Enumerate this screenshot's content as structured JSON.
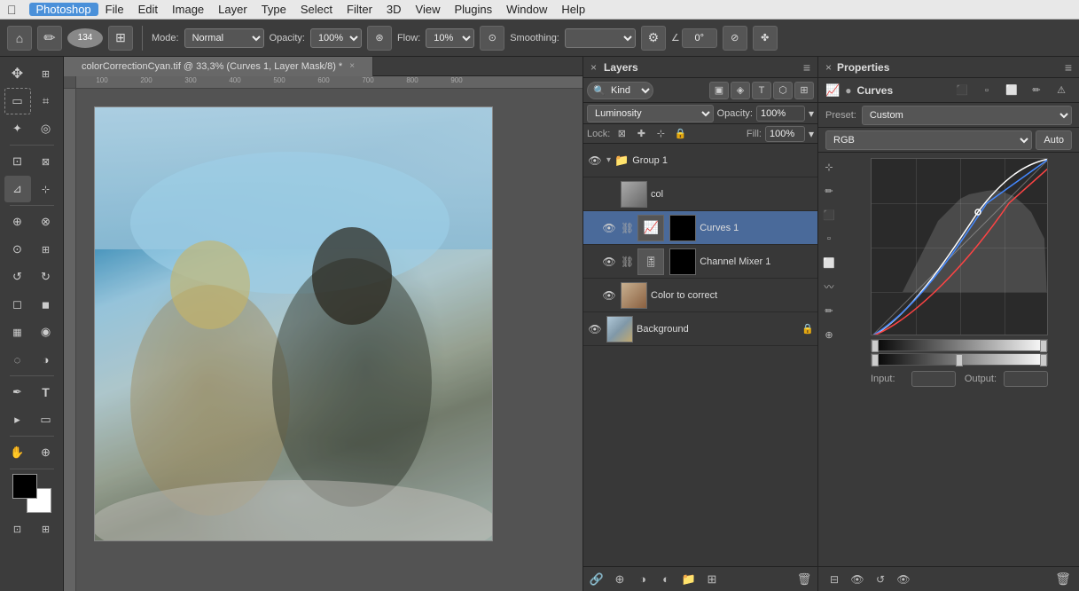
{
  "app": {
    "name": "Photoshop",
    "apple_symbol": ""
  },
  "menubar": {
    "items": [
      "Photoshop",
      "File",
      "Edit",
      "Image",
      "Layer",
      "Type",
      "Select",
      "Filter",
      "3D",
      "View",
      "Plugins",
      "Window",
      "Help"
    ]
  },
  "toolbar": {
    "mode_label": "Mode:",
    "mode_value": "Normal",
    "opacity_label": "Opacity:",
    "opacity_value": "100%",
    "flow_label": "Flow:",
    "flow_value": "10%",
    "smoothing_label": "Smoothing:",
    "smoothing_value": ""
  },
  "tab": {
    "title": "colorCorrectionCyan.tif @ 33,3% (Curves 1, Layer Mask/8) *",
    "close": "×"
  },
  "layers": {
    "panel_title": "Layers",
    "search_placeholder": "Kind",
    "blend_mode": "Luminosity",
    "opacity_label": "Opacity:",
    "opacity_value": "100%",
    "lock_label": "Lock:",
    "fill_label": "Fill:",
    "fill_value": "100%",
    "items": [
      {
        "name": "Group 1",
        "type": "group",
        "visible": true,
        "active": false
      },
      {
        "name": "col",
        "type": "layer",
        "visible": false,
        "active": false,
        "indent": true
      },
      {
        "name": "Curves 1",
        "type": "adjustment",
        "visible": true,
        "active": true,
        "indent": true,
        "has_mask": true
      },
      {
        "name": "Channel Mixer 1",
        "type": "adjustment",
        "visible": true,
        "active": false,
        "indent": true,
        "has_mask": true
      },
      {
        "name": "Color to correct",
        "type": "layer",
        "visible": true,
        "active": false,
        "indent": true
      },
      {
        "name": "Background",
        "type": "layer",
        "visible": true,
        "active": false,
        "locked": true
      }
    ]
  },
  "properties": {
    "panel_title": "Properties",
    "adjustment_title": "Curves",
    "preset_label": "Preset:",
    "preset_value": "Custom",
    "channel_value": "RGB",
    "auto_btn": "Auto",
    "input_label": "Input:",
    "output_label": "Output:",
    "input_value": "",
    "output_value": "",
    "icons": [
      "add-point-icon",
      "delete-point-icon",
      "corner-point-icon",
      "smooth-point-icon",
      "pencil-icon",
      "histogram-icon",
      "trash-icon"
    ]
  },
  "curves_data": {
    "white_line": "M0,200 L200,0",
    "blue_line": "M0,200 C50,160 80,100 120,60 L200,0",
    "red_line": "M0,200 C40,180 100,120 160,40 L200,10"
  }
}
